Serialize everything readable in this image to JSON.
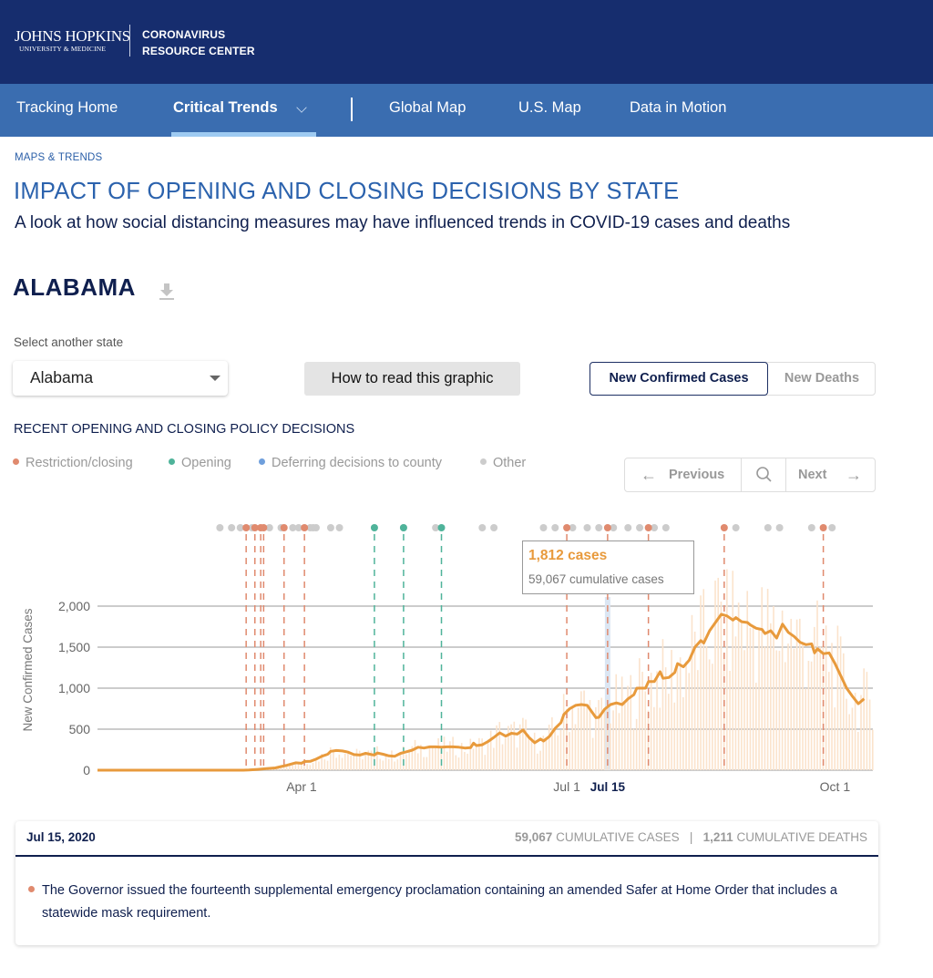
{
  "header": {
    "logo_line1": "JOHNS HOPKINS",
    "logo_line2": "UNIVERSITY & MEDICINE",
    "site_name_line1": "CORONAVIRUS",
    "site_name_line2": "RESOURCE CENTER"
  },
  "nav": {
    "items": [
      {
        "label": "Tracking Home",
        "active": false
      },
      {
        "label": "Critical Trends",
        "active": true,
        "has_dropdown": true
      },
      {
        "label": "Global Map",
        "active": false
      },
      {
        "label": "U.S. Map",
        "active": false
      },
      {
        "label": "Data in Motion",
        "active": false
      }
    ]
  },
  "page": {
    "eyebrow": "MAPS & TRENDS",
    "title": "IMPACT OF OPENING AND CLOSING DECISIONS BY STATE",
    "subtitle": "A look at how social distancing measures may have influenced trends in COVID-19 cases and deaths",
    "state_title": "ALABAMA",
    "download_icon": "download-icon"
  },
  "controls": {
    "select_label": "Select another state",
    "selected_state": "Alabama",
    "how_to_read": "How to read this graphic",
    "toggle_cases": "New Confirmed Cases",
    "toggle_deaths": "New Deaths",
    "toggle_selected": "New Confirmed Cases"
  },
  "policy": {
    "heading": "RECENT OPENING AND CLOSING POLICY DECISIONS",
    "legend": [
      {
        "label": "Restriction/closing",
        "color": "#e08a6e"
      },
      {
        "label": "Opening",
        "color": "#4fb39a"
      },
      {
        "label": "Deferring decisions to county",
        "color": "#6f9fdc"
      },
      {
        "label": "Other",
        "color": "#cccccc"
      }
    ]
  },
  "pager": {
    "previous": "Previous",
    "next": "Next",
    "search_icon": "search-icon"
  },
  "tooltip": {
    "cases": "1,812 cases",
    "cumulative": "59,067 cumulative cases"
  },
  "colors": {
    "line": "#e89a3c",
    "bars": "#fbe3cc",
    "restriction": "#e08a6e",
    "opening": "#4fb39a",
    "deferring": "#6f9fdc",
    "other": "#cccccc",
    "highlight": "#dbe6f3",
    "grid": "#cccccc"
  },
  "chart_data": {
    "type": "line",
    "title": "",
    "xlabel": "",
    "ylabel": "New Confirmed Cases",
    "ylim": [
      0,
      2000
    ],
    "yticks": [
      0,
      500,
      1000,
      1500,
      2000
    ],
    "ytick_labels": [
      "0",
      "500",
      "1,000",
      "1,500",
      "2,000"
    ],
    "x_range_days": [
      0,
      266
    ],
    "x_origin_date": "2020-01-22",
    "xticks": [
      {
        "day": 70,
        "label": "Apr 1"
      },
      {
        "day": 161,
        "label": "Jul 1"
      },
      {
        "day": 175,
        "label": "Jul 15",
        "highlight": true
      },
      {
        "day": 253,
        "label": "Oct 1"
      }
    ],
    "grid": true,
    "series": [
      {
        "name": "7-day average new confirmed cases",
        "points": [
          [
            0,
            0
          ],
          [
            50,
            0
          ],
          [
            52,
            2
          ],
          [
            55,
            10
          ],
          [
            58,
            20
          ],
          [
            61,
            28
          ],
          [
            63,
            45
          ],
          [
            65,
            60
          ],
          [
            67,
            80
          ],
          [
            68,
            90
          ],
          [
            70,
            85
          ],
          [
            71,
            105
          ],
          [
            73,
            108
          ],
          [
            75,
            135
          ],
          [
            77,
            170
          ],
          [
            79,
            195
          ],
          [
            80,
            230
          ],
          [
            82,
            240
          ],
          [
            84,
            235
          ],
          [
            86,
            220
          ],
          [
            88,
            190
          ],
          [
            90,
            185
          ],
          [
            92,
            205
          ],
          [
            94,
            190
          ],
          [
            95,
            185
          ],
          [
            96,
            210
          ],
          [
            98,
            195
          ],
          [
            100,
            175
          ],
          [
            102,
            170
          ],
          [
            104,
            205
          ],
          [
            106,
            225
          ],
          [
            108,
            245
          ],
          [
            110,
            280
          ],
          [
            112,
            270
          ],
          [
            114,
            285
          ],
          [
            116,
            285
          ],
          [
            118,
            280
          ],
          [
            120,
            285
          ],
          [
            122,
            285
          ],
          [
            124,
            280
          ],
          [
            126,
            270
          ],
          [
            128,
            275
          ],
          [
            129,
            330
          ],
          [
            130,
            300
          ],
          [
            132,
            310
          ],
          [
            134,
            350
          ],
          [
            136,
            400
          ],
          [
            138,
            455
          ],
          [
            140,
            415
          ],
          [
            142,
            450
          ],
          [
            144,
            440
          ],
          [
            146,
            490
          ],
          [
            148,
            400
          ],
          [
            150,
            335
          ],
          [
            152,
            380
          ],
          [
            153,
            355
          ],
          [
            155,
            410
          ],
          [
            157,
            510
          ],
          [
            159,
            580
          ],
          [
            160,
            680
          ],
          [
            162,
            750
          ],
          [
            164,
            790
          ],
          [
            166,
            800
          ],
          [
            168,
            790
          ],
          [
            170,
            690
          ],
          [
            171,
            640
          ],
          [
            172,
            645
          ],
          [
            174,
            745
          ],
          [
            176,
            800
          ],
          [
            178,
            820
          ],
          [
            180,
            800
          ],
          [
            182,
            870
          ],
          [
            184,
            920
          ],
          [
            185,
            1000
          ],
          [
            186,
            1000
          ],
          [
            188,
            1000
          ],
          [
            189,
            1080
          ],
          [
            191,
            1080
          ],
          [
            193,
            1200
          ],
          [
            194,
            1120
          ],
          [
            196,
            1130
          ],
          [
            198,
            1190
          ],
          [
            199,
            1300
          ],
          [
            201,
            1260
          ],
          [
            203,
            1340
          ],
          [
            205,
            1500
          ],
          [
            207,
            1580
          ],
          [
            208,
            1550
          ],
          [
            210,
            1700
          ],
          [
            212,
            1800
          ],
          [
            214,
            1900
          ],
          [
            216,
            1880
          ],
          [
            218,
            1830
          ],
          [
            219,
            1860
          ],
          [
            221,
            1810
          ],
          [
            223,
            1800
          ],
          [
            224,
            1770
          ],
          [
            226,
            1730
          ],
          [
            228,
            1715
          ],
          [
            229,
            1665
          ],
          [
            231,
            1700
          ],
          [
            233,
            1610
          ],
          [
            235,
            1780
          ],
          [
            237,
            1680
          ],
          [
            239,
            1630
          ],
          [
            241,
            1560
          ],
          [
            243,
            1530
          ],
          [
            245,
            1540
          ],
          [
            246,
            1430
          ],
          [
            247,
            1480
          ],
          [
            249,
            1420
          ],
          [
            251,
            1430
          ],
          [
            253,
            1300
          ],
          [
            255,
            1150
          ],
          [
            257,
            1000
          ],
          [
            259,
            900
          ],
          [
            261,
            810
          ],
          [
            263,
            870
          ]
        ],
        "note": "points are [day_offset, value]; line series as seen (7-day rolling average)"
      }
    ],
    "highlight_date": {
      "day": 175,
      "label": "Jul 15",
      "value": 1812,
      "cumulative_cases": 59067
    },
    "policy_event_lines": [
      {
        "day": 51,
        "type": "restriction"
      },
      {
        "day": 54,
        "type": "restriction"
      },
      {
        "day": 56,
        "type": "restriction"
      },
      {
        "day": 57,
        "type": "restriction"
      },
      {
        "day": 64,
        "type": "restriction"
      },
      {
        "day": 71,
        "type": "restriction"
      },
      {
        "day": 95,
        "type": "opening"
      },
      {
        "day": 105,
        "type": "opening"
      },
      {
        "day": 118,
        "type": "opening"
      },
      {
        "day": 161,
        "type": "restriction"
      },
      {
        "day": 175,
        "type": "restriction"
      },
      {
        "day": 189,
        "type": "restriction"
      },
      {
        "day": 215,
        "type": "restriction"
      },
      {
        "day": 249,
        "type": "restriction"
      }
    ],
    "policy_dots_other_days": [
      42,
      46,
      49,
      53,
      59,
      63,
      67,
      69,
      73,
      74,
      75,
      80,
      83,
      105,
      116,
      132,
      136,
      153,
      157,
      163,
      168,
      172,
      177,
      182,
      186,
      191,
      195,
      219,
      230,
      234,
      245,
      252
    ]
  },
  "detail": {
    "date": "Jul 15, 2020",
    "cumulative_cases_value": "59,067",
    "cumulative_cases_label": "CUMULATIVE CASES",
    "separator": "|",
    "cumulative_deaths_value": "1,211",
    "cumulative_deaths_label": "CUMULATIVE DEATHS",
    "event_type": "restriction",
    "event_text": "The Governor issued the fourteenth supplemental emergency proclamation containing an amended Safer at Home Order that includes a statewide mask requirement."
  }
}
